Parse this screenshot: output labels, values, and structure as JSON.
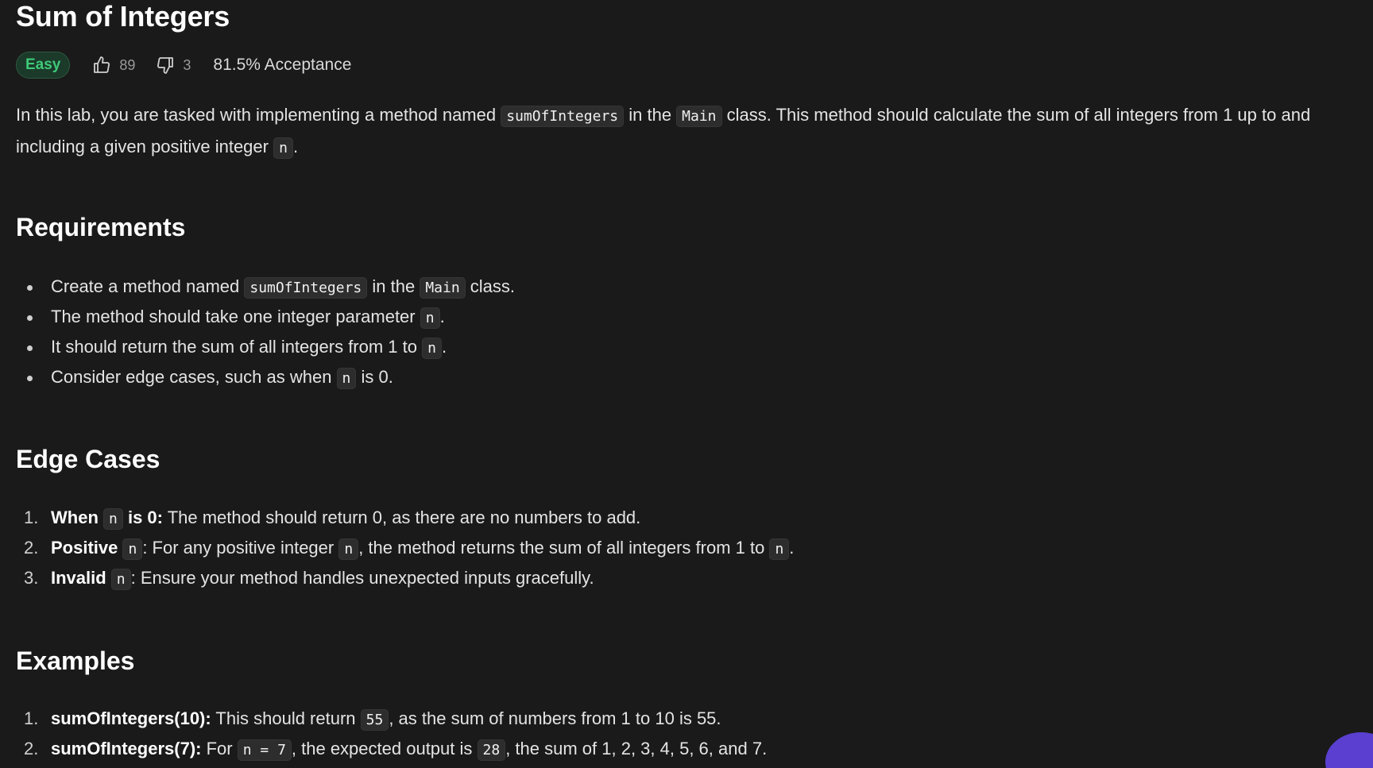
{
  "problem": {
    "title": "Sum of Integers",
    "difficulty": "Easy",
    "likes": "89",
    "dislikes": "3",
    "acceptance": "81.5% Acceptance"
  },
  "intro": {
    "t1": "In this lab, you are tasked with implementing a method named ",
    "c1": "sumOfIntegers",
    "t2": " in the ",
    "c2": "Main",
    "t3": " class. This method should calculate the sum of all integers from 1 up to and including a given positive integer ",
    "c3": "n",
    "t4": "."
  },
  "requirements": {
    "heading": "Requirements",
    "items": [
      {
        "t1": "Create a method named ",
        "c1": "sumOfIntegers",
        "t2": " in the ",
        "c2": "Main",
        "t3": " class."
      },
      {
        "t1": "The method should take one integer parameter ",
        "c1": "n",
        "t2": "."
      },
      {
        "t1": "It should return the sum of all integers from 1 to ",
        "c1": "n",
        "t2": "."
      },
      {
        "t1": "Consider edge cases, such as when ",
        "c1": "n",
        "t2": " is 0."
      }
    ]
  },
  "edge_cases": {
    "heading": "Edge Cases",
    "items": [
      {
        "num": "1.",
        "b1": "When ",
        "c1": "n",
        "b2": " is 0:",
        "t1": " The method should return 0, as there are no numbers to add."
      },
      {
        "num": "2.",
        "b1": "Positive ",
        "c1": "n",
        "t1": ": For any positive integer ",
        "c2": "n",
        "t2": ", the method returns the sum of all integers from 1 to ",
        "c3": "n",
        "t3": "."
      },
      {
        "num": "3.",
        "b1": "Invalid ",
        "c1": "n",
        "t1": ": Ensure your method handles unexpected inputs gracefully."
      }
    ]
  },
  "examples": {
    "heading": "Examples",
    "items": [
      {
        "num": "1.",
        "b1": "sumOfIntegers(10):",
        "t1": " This should return ",
        "c1": "55",
        "t2": ", as the sum of numbers from 1 to 10 is 55."
      },
      {
        "num": "2.",
        "b1": "sumOfIntegers(7):",
        "t1": " For ",
        "c1": "n = 7",
        "t2": ", the expected output is ",
        "c2": "28",
        "t3": ", the sum of 1, 2, 3, 4, 5, 6, and 7."
      }
    ]
  },
  "colors": {
    "background": "#1a1a1a",
    "easy": "#3fc978",
    "accent_blob": "#5b3fd1"
  }
}
